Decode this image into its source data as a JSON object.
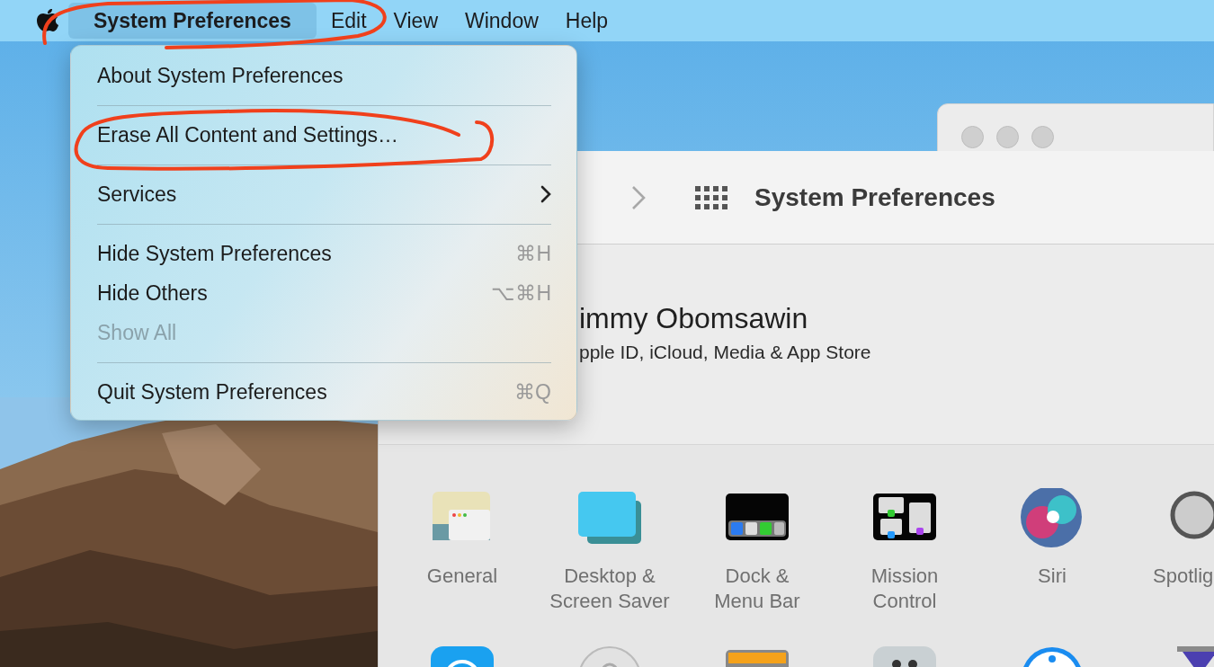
{
  "menu_bar": {
    "items": [
      {
        "label": "System Preferences",
        "selected": true
      },
      {
        "label": "Edit",
        "selected": false
      },
      {
        "label": "View",
        "selected": false
      },
      {
        "label": "Window",
        "selected": false
      },
      {
        "label": "Help",
        "selected": false
      }
    ]
  },
  "app_menu": {
    "items": [
      {
        "kind": "item",
        "label": "About System Preferences",
        "disabled": false
      },
      {
        "kind": "separator"
      },
      {
        "kind": "item",
        "label": "Erase All Content and Settings…",
        "disabled": false
      },
      {
        "kind": "separator"
      },
      {
        "kind": "item",
        "label": "Services",
        "disabled": false,
        "submenu": true
      },
      {
        "kind": "separator"
      },
      {
        "kind": "item",
        "label": "Hide System Preferences",
        "disabled": false,
        "shortcut": "⌘H"
      },
      {
        "kind": "item",
        "label": "Hide Others",
        "disabled": false,
        "shortcut": "⌥⌘H"
      },
      {
        "kind": "item",
        "label": "Show All",
        "disabled": true
      },
      {
        "kind": "separator"
      },
      {
        "kind": "item",
        "label": "Quit System Preferences",
        "disabled": false,
        "shortcut": "⌘Q"
      }
    ]
  },
  "window": {
    "title": "System Preferences",
    "account": {
      "name": "immy Obomsawin",
      "subtitle": "pple ID, iCloud, Media & App Store"
    },
    "preferences": [
      {
        "kind": "general",
        "label": "General"
      },
      {
        "kind": "desktop",
        "label": "Desktop &\nScreen Saver"
      },
      {
        "kind": "dock",
        "label": "Dock &\nMenu Bar"
      },
      {
        "kind": "mission",
        "label": "Mission\nControl"
      },
      {
        "kind": "siri",
        "label": "Siri"
      },
      {
        "kind": "spotlight",
        "label": "Spotlig"
      }
    ],
    "more_preferences": [
      {
        "kind": "blue"
      },
      {
        "kind": "disc"
      },
      {
        "kind": "wallet"
      },
      {
        "kind": "gray"
      },
      {
        "kind": "accessibility"
      },
      {
        "kind": "hourglass"
      }
    ]
  },
  "markup": [
    {
      "kind": "freehand"
    },
    {
      "kind": "freehand"
    }
  ]
}
